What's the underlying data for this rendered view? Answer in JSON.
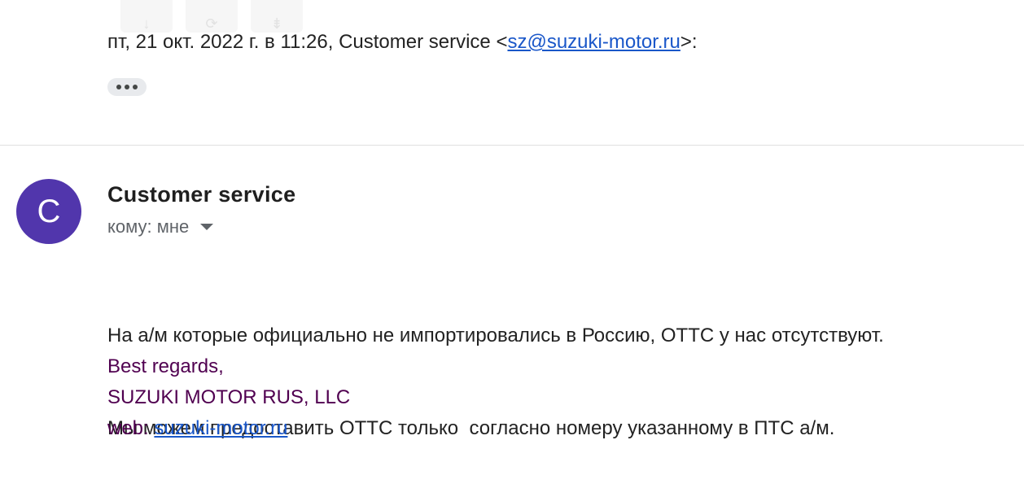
{
  "top_chips": [
    "↓",
    "⟳",
    "⇟"
  ],
  "quote": {
    "prefix": "пт, 21 окт. 2022 г. в 11:26, Customer service <",
    "email": "sz@suzuki-motor.ru",
    "suffix": ">:"
  },
  "message": {
    "avatar_letter": "C",
    "sender_name": "Customer service",
    "recipient_label": "кому: мне",
    "body_lines": [
      "На а/м которые официально не импортировались в Россию, ОТТС у нас отсутствуют.",
      "Мы можем предоставить ОТТС только  согласно номеру указанному в ПТС а/м."
    ],
    "signature": {
      "greeting": "Best regards,",
      "company": "SUZUKI MOTOR RUS, LLC",
      "web_label": "web: ",
      "web_link": "suzuki-motor.ru"
    }
  },
  "colors": {
    "avatar_bg": "#5136ac",
    "link": "#1a57c9",
    "signature": "#500050"
  }
}
